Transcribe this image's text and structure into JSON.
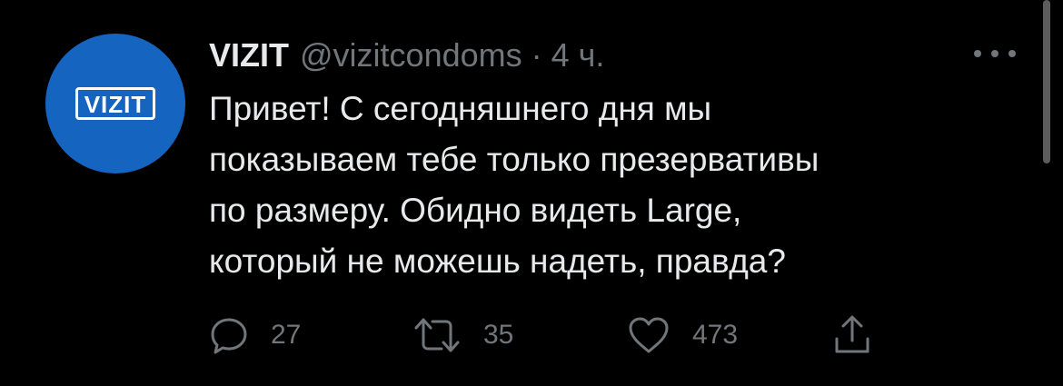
{
  "author": {
    "avatar_text": "VIZIT",
    "display_name": "VIZIT",
    "handle": "@vizitcondoms",
    "separator": "·",
    "time": "4 ч."
  },
  "tweet": {
    "text": "Привет! С сегодняшнего дня мы\nпоказываем тебе только презервативы\nпо размеру. Обидно видеть Large,\nкоторый не можешь надеть, правда?"
  },
  "actions": {
    "reply": {
      "icon": "reply-icon",
      "count": "27"
    },
    "retweet": {
      "icon": "retweet-icon",
      "count": "35"
    },
    "like": {
      "icon": "heart-icon",
      "count": "473"
    },
    "share": {
      "icon": "share-icon"
    }
  },
  "colors": {
    "background": "#000000",
    "text_primary": "#e7e9ea",
    "text_secondary": "#71767b",
    "avatar_bg": "#1565c0"
  }
}
